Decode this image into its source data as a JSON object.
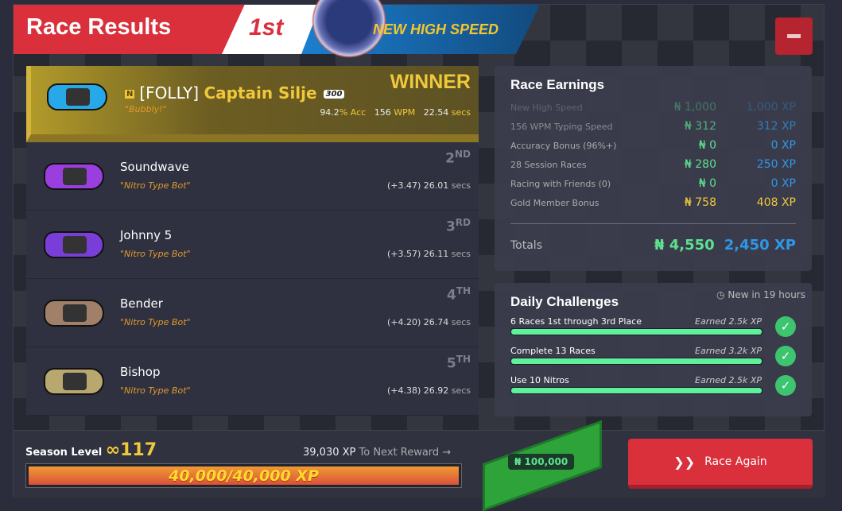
{
  "header": {
    "title": "Race Results",
    "place": "1st",
    "banner": "NEW HIGH SPEED"
  },
  "winner": {
    "label": "WINNER",
    "tag": "[FOLLY]",
    "name": "Captain Silje",
    "level_badge": "300",
    "quote": "\"Bubbly!\"",
    "acc_value": "94.2",
    "acc_label": "% Acc",
    "wpm_value": "156",
    "wpm_label": "WPM",
    "time_value": "22.54",
    "time_label": "secs",
    "car_color": "#27a8e8"
  },
  "racers": [
    {
      "place": "2",
      "suffix": "ND",
      "name": "Soundwave",
      "quote": "\"Nitro Type Bot\"",
      "time": "(+3.47) 26.01",
      "unit": "secs",
      "car_color": "#9b3ee0"
    },
    {
      "place": "3",
      "suffix": "RD",
      "name": "Johnny 5",
      "quote": "\"Nitro Type Bot\"",
      "time": "(+3.57) 26.11",
      "unit": "secs",
      "car_color": "#7a3ed8"
    },
    {
      "place": "4",
      "suffix": "TH",
      "name": "Bender",
      "quote": "\"Nitro Type Bot\"",
      "time": "(+4.20) 26.74",
      "unit": "secs",
      "car_color": "#a08068"
    },
    {
      "place": "5",
      "suffix": "TH",
      "name": "Bishop",
      "quote": "\"Nitro Type Bot\"",
      "time": "(+4.38) 26.92",
      "unit": "secs",
      "car_color": "#b8a870"
    }
  ],
  "earnings": {
    "title": "Race Earnings",
    "rows": [
      {
        "label": "New High Speed",
        "nitro": "₦ 1,000",
        "xp": "1,000 XP"
      },
      {
        "label": "156 WPM Typing Speed",
        "nitro": "₦ 312",
        "xp": "312 XP"
      },
      {
        "label": "Accuracy Bonus (96%+)",
        "nitro": "₦ 0",
        "xp": "0 XP"
      },
      {
        "label": "28 Session Races",
        "nitro": "₦ 280",
        "xp": "250 XP"
      },
      {
        "label": "Racing with Friends (0)",
        "nitro": "₦ 0",
        "xp": "0 XP"
      },
      {
        "label": "Gold Member Bonus",
        "nitro": "₦ 758",
        "xp": "408 XP"
      }
    ],
    "totals_label": "Totals",
    "total_nitro": "₦ 4,550",
    "total_xp": "2,450 XP"
  },
  "challenges": {
    "title": "Daily Challenges",
    "refresh": "New in 19 hours",
    "items": [
      {
        "label": "6 Races 1st through 3rd Place",
        "earned": "Earned 2.5k XP",
        "progress": 100
      },
      {
        "label": "Complete 13 Races",
        "earned": "Earned 3.2k XP",
        "progress": 100
      },
      {
        "label": "Use 10 Nitros",
        "earned": "Earned 2.5k XP",
        "progress": 100
      }
    ]
  },
  "season": {
    "label": "Season Level",
    "level": "∞117",
    "next_value": "39,030 XP",
    "next_label": "To Next Reward →",
    "progress_text": "40,000/40,000 XP",
    "progress": 100,
    "reward": "₦ 100,000"
  },
  "actions": {
    "race_again": "Race Again"
  },
  "colors": {
    "accent_red": "#d9303c",
    "gold": "#f0c93a",
    "nitro_green": "#5de18f",
    "xp_blue": "#2f97e8"
  }
}
